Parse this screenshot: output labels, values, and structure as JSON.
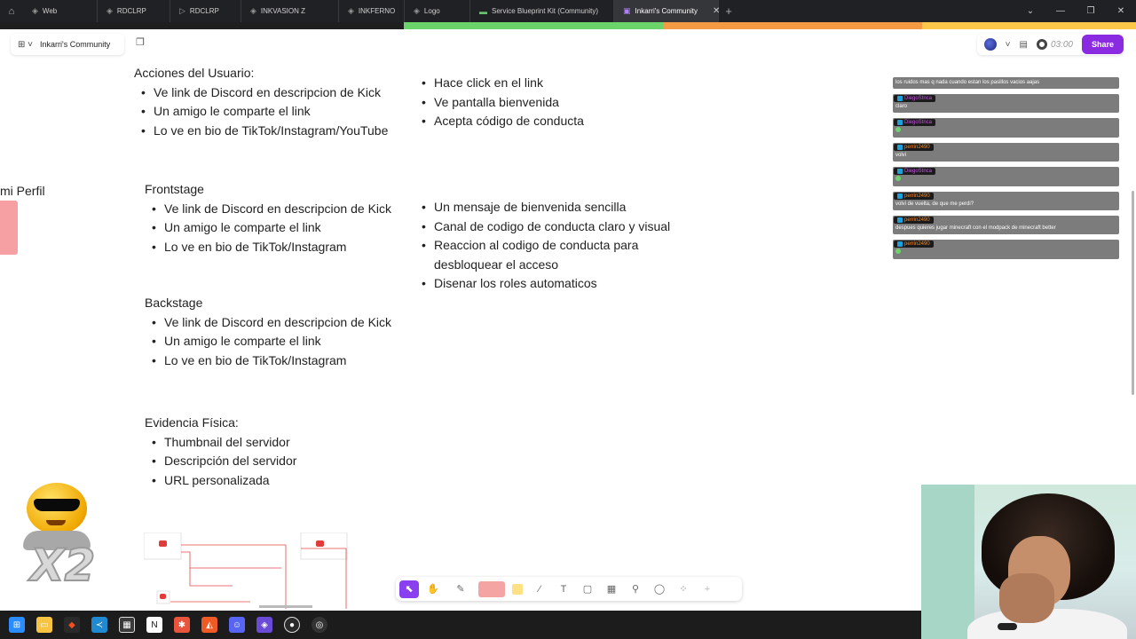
{
  "browser": {
    "tabs": [
      {
        "label": "Web",
        "icon": "figma-icon"
      },
      {
        "label": "RDCLRP",
        "icon": "figma-icon"
      },
      {
        "label": "RDCLRP",
        "icon": "play-icon"
      },
      {
        "label": "INKVASION Z",
        "icon": "figma-icon"
      },
      {
        "label": "INKFERNO",
        "icon": "figma-icon"
      },
      {
        "label": "Logo",
        "icon": "figma-icon"
      },
      {
        "label": "Service Blueprint Kit (Community)",
        "icon": "slides-icon"
      },
      {
        "label": "Inkarri's Community",
        "icon": "figjam-icon",
        "active": true
      }
    ]
  },
  "stripe_colors": [
    "#1e1e1e",
    "#6ad36a",
    "#f39a43",
    "#ffc84a"
  ],
  "header": {
    "file_name": "Inkarri's Community",
    "timer": "03:00",
    "share_label": "Share",
    "accent": "#8a2be2"
  },
  "blocks": {
    "user_actions": {
      "heading": "Acciones del Usuario:",
      "items": [
        "Ve link de Discord en descripcion de Kick",
        "Un amigo le comparte el link",
        "Lo ve en bio de TikTok/Instagram/YouTube"
      ]
    },
    "user_actions_right": {
      "items": [
        "Hace click en el link",
        "Ve pantalla bienvenida",
        "Acepta código de conducta"
      ]
    },
    "frontstage": {
      "heading": "Frontstage",
      "items": [
        "Ve link de Discord en descripcion de Kick",
        "Un amigo le comparte el link",
        "Lo ve en bio de TikTok/Instagram"
      ]
    },
    "frontstage_right": {
      "items": [
        "Un mensaje de bienvenida sencilla",
        "Canal de codigo de conducta claro y visual",
        "Reaccion al codigo de conducta para desbloquear el acceso",
        "Disenar los roles automaticos"
      ]
    },
    "backstage": {
      "heading": "Backstage",
      "items": [
        "Ve link de Discord en descripcion de Kick",
        "Un amigo le comparte el link",
        "Lo ve en bio de TikTok/Instagram"
      ]
    },
    "evidence": {
      "heading": "Evidencia Física:",
      "items": [
        "Thumbnail del servidor",
        "Descripción del servidor",
        "URL personalizada"
      ]
    },
    "mi_perfil": "mi Perfil"
  },
  "chat": {
    "messages": [
      {
        "user": "",
        "text": "los ruidos mas q nada cuando estan los pasillos vacios aajas"
      },
      {
        "user": "DiegoStnca",
        "user_class": "u1",
        "text": "claro"
      },
      {
        "user": "DiegoStnca",
        "user_class": "u1",
        "text": "",
        "emote": true
      },
      {
        "user": "perrin2490",
        "user_class": "u2",
        "text": "volvi"
      },
      {
        "user": "DiegoStnca",
        "user_class": "u1",
        "text": "",
        "emote": true
      },
      {
        "user": "perrin2490",
        "user_class": "u2",
        "text": "volvi de vuelta, de que me perdi?"
      },
      {
        "user": "perrin2490",
        "user_class": "u2",
        "text": "despues quieres jugar minecraft con el modpack de minecraft better"
      },
      {
        "user": "perrin2490",
        "user_class": "u2",
        "text": "",
        "emote": true
      }
    ]
  },
  "meme": {
    "label": "X2"
  },
  "toolbar": {
    "tools": [
      "select-tool",
      "hand-tool",
      "marker-tool",
      "shapes-tool",
      "sticky-note-tool",
      "connector-tool",
      "text-tool",
      "section-tool",
      "table-tool",
      "stamp-tool",
      "comment-tool",
      "more-tools",
      "add-tool"
    ]
  },
  "taskbar": {
    "apps": [
      {
        "name": "windows-start-icon",
        "color": "#2a8cff"
      },
      {
        "name": "file-explorer-icon",
        "color": "#f6c342"
      },
      {
        "name": "figma-app-icon",
        "color": "#1e1e1e"
      },
      {
        "name": "vscode-icon",
        "color": "#1f8ad2"
      },
      {
        "name": "calendar-icon",
        "color": "#3a3a3a"
      },
      {
        "name": "notion-icon",
        "color": "#ffffff"
      },
      {
        "name": "app-red-icon",
        "color": "#e8543c"
      },
      {
        "name": "brave-icon",
        "color": "#f05a24"
      },
      {
        "name": "discord-icon",
        "color": "#5865f2"
      },
      {
        "name": "app-purple-icon",
        "color": "#6a4bd8"
      },
      {
        "name": "obs-icon",
        "color": "#2b2b2b"
      },
      {
        "name": "chrome-icon",
        "color": "#333333"
      }
    ]
  }
}
